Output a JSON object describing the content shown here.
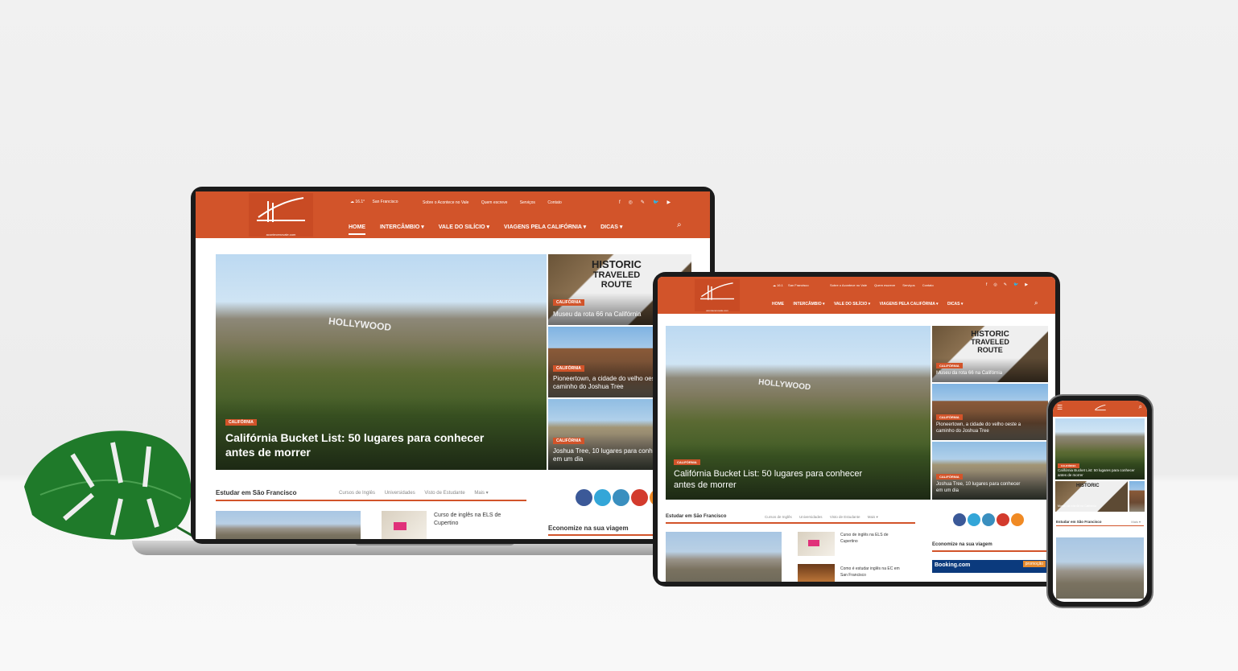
{
  "site": {
    "logo_text": "acontecenovale.com",
    "weather_temp": "16.1",
    "weather_unit": "°",
    "weather_city": "San Francisco",
    "top_links": [
      "Sobre o Acontece no Vale",
      "Quem escreve",
      "Serviços",
      "Contato"
    ],
    "social_top": [
      "f",
      "◎",
      "✎",
      "🐦",
      "▶"
    ],
    "menu": [
      "HOME",
      "INTERCÂMBIO ▾",
      "VALE DO SILÍCIO ▾",
      "VIAGENS PELA CALIFÓRNIA ▾",
      "DICAS ▾"
    ],
    "search_icon": "⌕"
  },
  "hero": {
    "tag": "CALIFÓRNIA",
    "title_line1": "Califórnia Bucket List: 50 lugares para conhecer",
    "title_line2": "antes de morrer",
    "hollywood": "HOLLYWOOD"
  },
  "side_posts": [
    {
      "tag": "CALIFÓRNIA",
      "title": "Museu da rota 66 na Califórnia",
      "sign1": "HISTORIC",
      "sign2": "TRAVELED",
      "sign3": "ROUTE"
    },
    {
      "tag": "CALIFÓRNIA",
      "title_line1": "Pioneertown, a cidade do velho oeste a",
      "title_line2": "caminho do Joshua Tree"
    },
    {
      "tag": "CALIFÓRNIA",
      "title_line1": "Joshua Tree, 10 lugares para conhecer",
      "title_line2": "em um dia"
    }
  ],
  "section": {
    "title": "Estudar em São Francisco",
    "tabs": [
      "Cursos de Inglês",
      "Universidades",
      "Visto de Estudante",
      "Mais ▾"
    ],
    "post1_line1": "Curso de inglês na ELS de",
    "post1_line2": "Cupertino",
    "post2_line1": "Como é estudar inglês na EC em",
    "post2_line2": "San Francisco",
    "sidebar_title": "Economize na sua viagem",
    "booking": "Booking.com",
    "promo": "promoção"
  },
  "phone": {
    "menu_icon": "☰",
    "more": "Mais ▾"
  }
}
